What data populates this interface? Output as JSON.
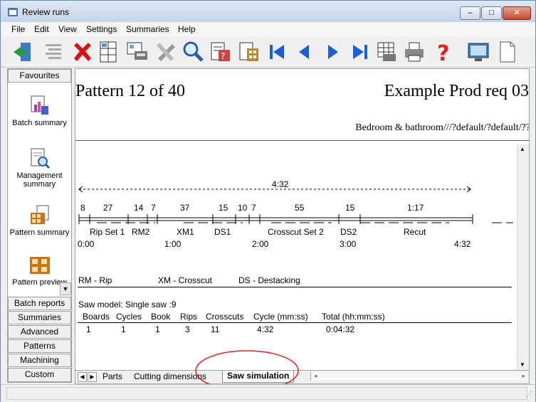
{
  "window": {
    "title": "Review runs"
  },
  "menu": [
    "File",
    "Edit",
    "View",
    "Settings",
    "Summaries",
    "Help"
  ],
  "toolbar_icons": [
    "exit-icon",
    "align-icon",
    "delete-icon",
    "grid-print-icon",
    "pattern-print-icon",
    "tools-icon",
    "search-icon",
    "report-icon",
    "report2-icon",
    "first-icon",
    "prev-icon",
    "next-icon",
    "last-icon",
    "grid-icon",
    "printer-icon",
    "help-icon",
    "monitor-icon",
    "page-icon"
  ],
  "sidebar": {
    "favourites": "Favourites",
    "items": [
      "Batch summary",
      "Management summary",
      "Pattern summary",
      "Pattern preview"
    ],
    "sections": [
      "Batch reports",
      "Summaries",
      "Advanced",
      "Patterns",
      "Machining",
      "Custom"
    ]
  },
  "report": {
    "pattern": "Pattern 12 of 40",
    "request": "Example Prod req 03",
    "material": "Bedroom & bathroom///?default/?default/??",
    "total_time": "4:32",
    "durations": [
      "8",
      "27",
      "14",
      "7",
      "37",
      "15",
      "10",
      "7",
      "55",
      "15",
      "1:17"
    ],
    "phases": [
      "Rip Set 1",
      "RM2",
      "XM1",
      "DS1",
      "Crosscut Set 2",
      "DS2",
      "Recut"
    ],
    "time_ticks": [
      "0:00",
      "1:00",
      "2:00",
      "3:00",
      "4:32"
    ],
    "legend": [
      "RM - Rip",
      "XM - Crosscut",
      "DS - Destacking"
    ],
    "saw_model": "Saw model: Single saw :9",
    "table": {
      "headers": [
        "Boards",
        "Cycles",
        "Book",
        "Rips",
        "Crosscuts",
        "Cycle (mm:ss)",
        "Total (hh:mm:ss)"
      ],
      "row": [
        "1",
        "1",
        "1",
        "3",
        "11",
        "4:32",
        "0:04:32"
      ]
    }
  },
  "tabs": [
    "Parts",
    "Cutting dimensions",
    "Saw simulation"
  ],
  "active_tab": "Saw simulation"
}
